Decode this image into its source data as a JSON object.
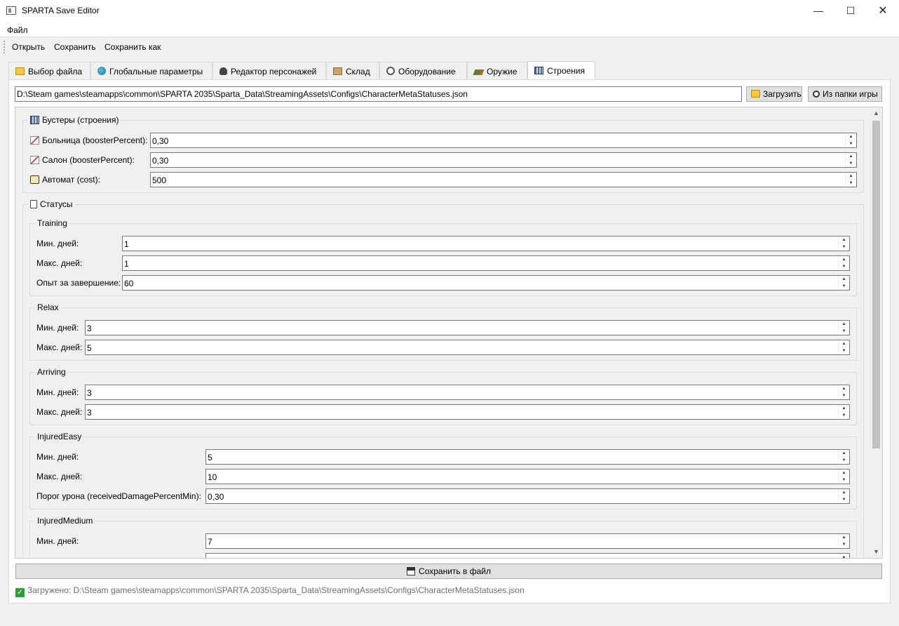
{
  "window": {
    "title": "SPARTA Save Editor",
    "minimize": "—",
    "maximize": "☐",
    "close": "✕"
  },
  "menu": {
    "file": "Файл"
  },
  "toolbar": {
    "open": "Открыть",
    "save": "Сохранить",
    "save_as": "Сохранить как"
  },
  "tabs": [
    {
      "label": "Выбор файла",
      "icon": "folder-icon"
    },
    {
      "label": "Глобальные параметры",
      "icon": "globe-icon"
    },
    {
      "label": "Редактор персонажей",
      "icon": "person-icon"
    },
    {
      "label": "Склад",
      "icon": "box-icon"
    },
    {
      "label": "Оборудование",
      "icon": "gear-icon"
    },
    {
      "label": "Оружие",
      "icon": "gun-icon"
    },
    {
      "label": "Строения",
      "icon": "building-icon",
      "active": true
    }
  ],
  "path": {
    "value": "D:\\Steam games\\steamapps\\common\\SPARTA 2035\\Sparta_Data\\StreamingAssets\\Configs\\CharacterMetaStatuses.json",
    "load_button": "Загрузить",
    "game_folder_button": "Из папки игры"
  },
  "boosters": {
    "title": "Бустеры (строения)",
    "rows": [
      {
        "label": "Больница (boosterPercent):",
        "value": "0,30"
      },
      {
        "label": "Салон (boosterPercent):",
        "value": "0,30"
      },
      {
        "label": "Автомат (cost):",
        "value": "500"
      }
    ]
  },
  "statuses": {
    "title": "Статусы",
    "groups": [
      {
        "title": "Training",
        "rows": [
          {
            "label": "Мин. дней:",
            "value": "1"
          },
          {
            "label": "Макс. дней:",
            "value": "1"
          },
          {
            "label": "Опыт за завершение:",
            "value": "60"
          }
        ]
      },
      {
        "title": "Relax",
        "rows": [
          {
            "label": "Мин. дней:",
            "value": "3"
          },
          {
            "label": "Макс. дней:",
            "value": "5"
          }
        ]
      },
      {
        "title": "Arriving",
        "rows": [
          {
            "label": "Мин. дней:",
            "value": "3"
          },
          {
            "label": "Макс. дней:",
            "value": "3"
          }
        ]
      },
      {
        "title": "InjuredEasy",
        "rows": [
          {
            "label": "Мин. дней:",
            "value": "5"
          },
          {
            "label": "Макс. дней:",
            "value": "10"
          },
          {
            "label": "Порог урона (receivedDamagePercentMin):",
            "value": "0,30"
          }
        ]
      },
      {
        "title": "InjuredMedium",
        "rows": [
          {
            "label": "Мин. дней:",
            "value": "7"
          }
        ]
      }
    ]
  },
  "save_button": "Сохранить в файл",
  "status_bar": "Загружено: D:\\Steam games\\steamapps\\common\\SPARTA 2035\\Sparta_Data\\StreamingAssets\\Configs\\CharacterMetaStatuses.json",
  "colors": {
    "success": "#2f9e3a",
    "window_bg": "#f0f0f0"
  }
}
